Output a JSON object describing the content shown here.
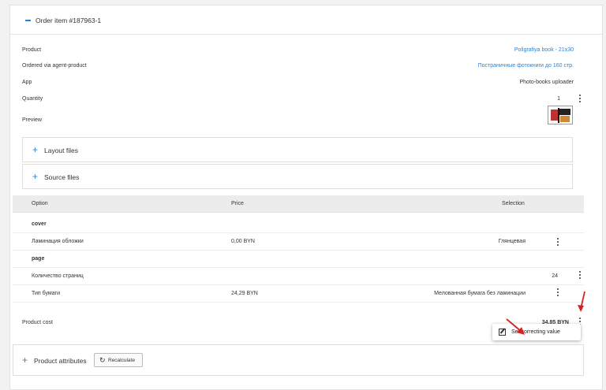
{
  "order": {
    "title": "Order item #187963-1",
    "details": {
      "product_label": "Product",
      "product_value": "Poligrafiya book - 21x30",
      "agent_label": "Ordered via agent-product",
      "agent_value": "Постраничные фотокниги до 160 стр.",
      "app_label": "App",
      "app_value": "Photo-books uploader",
      "quantity_label": "Quantity",
      "quantity_value": "1",
      "preview_label": "Preview"
    },
    "accordions": {
      "layout_files": "Layout files",
      "source_files": "Source files"
    },
    "table": {
      "headers": {
        "option": "Option",
        "price": "Price",
        "selection": "Selection"
      },
      "rows": [
        {
          "option": "cover",
          "price": "",
          "selection": ""
        },
        {
          "option": "Ламинация обложки",
          "price": "0,00 BYN",
          "selection": "Глянцевая"
        },
        {
          "option": "page",
          "price": "",
          "selection": ""
        },
        {
          "option": "Количество страниц",
          "price": "",
          "selection": "24"
        },
        {
          "option": "Тип бумаги",
          "price": "24,29 BYN",
          "selection": "Мелованная бумага без ламинации"
        }
      ]
    },
    "product_cost": {
      "label": "Product cost",
      "value": "34,85 BYN"
    },
    "context_menu": {
      "item": "Set correcting value"
    },
    "attributes": {
      "title": "Product attributes",
      "recalculate_label": "Recalculate"
    }
  },
  "colors": {
    "accent": "#2f80d0",
    "arrow": "#d6221e"
  }
}
